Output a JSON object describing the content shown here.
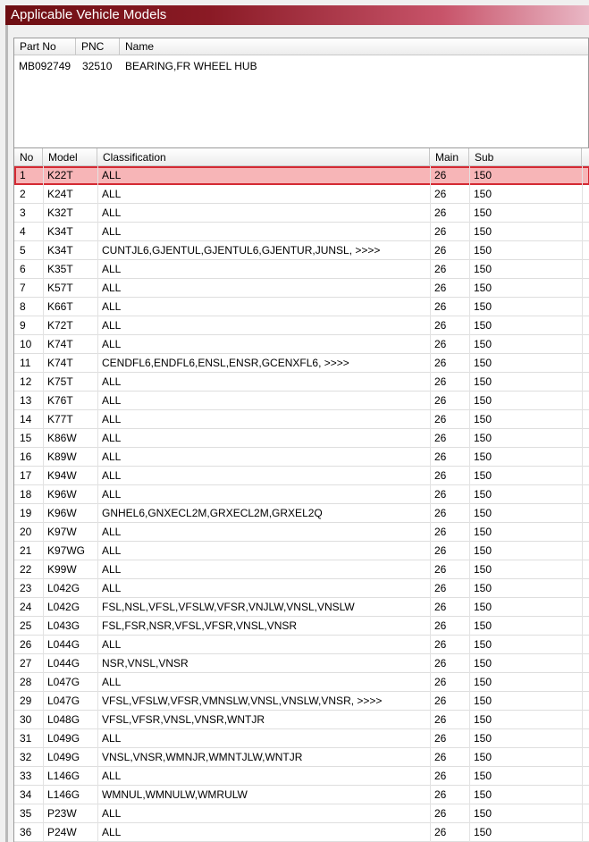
{
  "window": {
    "title": "Applicable Vehicle Models"
  },
  "part": {
    "headers": {
      "part_no": "Part No",
      "pnc": "PNC",
      "name": "Name"
    },
    "part_no": "MB092749",
    "pnc": "32510",
    "name": "BEARING,FR WHEEL HUB"
  },
  "grid": {
    "headers": {
      "no": "No",
      "model": "Model",
      "classification": "Classification",
      "main": "Main",
      "sub": "Sub"
    },
    "selected_row": 1,
    "rows": [
      {
        "no": "1",
        "model": "K22T",
        "classification": "ALL",
        "main": "26",
        "sub": "150"
      },
      {
        "no": "2",
        "model": "K24T",
        "classification": "ALL",
        "main": "26",
        "sub": "150"
      },
      {
        "no": "3",
        "model": "K32T",
        "classification": "ALL",
        "main": "26",
        "sub": "150"
      },
      {
        "no": "4",
        "model": "K34T",
        "classification": "ALL",
        "main": "26",
        "sub": "150"
      },
      {
        "no": "5",
        "model": "K34T",
        "classification": "CUNTJL6,GJENTUL,GJENTUL6,GJENTUR,JUNSL,   >>>>",
        "main": "26",
        "sub": "150"
      },
      {
        "no": "6",
        "model": "K35T",
        "classification": "ALL",
        "main": "26",
        "sub": "150"
      },
      {
        "no": "7",
        "model": "K57T",
        "classification": "ALL",
        "main": "26",
        "sub": "150"
      },
      {
        "no": "8",
        "model": "K66T",
        "classification": "ALL",
        "main": "26",
        "sub": "150"
      },
      {
        "no": "9",
        "model": "K72T",
        "classification": "ALL",
        "main": "26",
        "sub": "150"
      },
      {
        "no": "10",
        "model": "K74T",
        "classification": "ALL",
        "main": "26",
        "sub": "150"
      },
      {
        "no": "11",
        "model": "K74T",
        "classification": "CENDFL6,ENDFL6,ENSL,ENSR,GCENXFL6,   >>>>",
        "main": "26",
        "sub": "150"
      },
      {
        "no": "12",
        "model": "K75T",
        "classification": "ALL",
        "main": "26",
        "sub": "150"
      },
      {
        "no": "13",
        "model": "K76T",
        "classification": "ALL",
        "main": "26",
        "sub": "150"
      },
      {
        "no": "14",
        "model": "K77T",
        "classification": "ALL",
        "main": "26",
        "sub": "150"
      },
      {
        "no": "15",
        "model": "K86W",
        "classification": "ALL",
        "main": "26",
        "sub": "150"
      },
      {
        "no": "16",
        "model": "K89W",
        "classification": "ALL",
        "main": "26",
        "sub": "150"
      },
      {
        "no": "17",
        "model": "K94W",
        "classification": "ALL",
        "main": "26",
        "sub": "150"
      },
      {
        "no": "18",
        "model": "K96W",
        "classification": "ALL",
        "main": "26",
        "sub": "150"
      },
      {
        "no": "19",
        "model": "K96W",
        "classification": "GNHEL6,GNXECL2M,GRXECL2M,GRXEL2Q",
        "main": "26",
        "sub": "150"
      },
      {
        "no": "20",
        "model": "K97W",
        "classification": "ALL",
        "main": "26",
        "sub": "150"
      },
      {
        "no": "21",
        "model": "K97WG",
        "classification": "ALL",
        "main": "26",
        "sub": "150"
      },
      {
        "no": "22",
        "model": "K99W",
        "classification": "ALL",
        "main": "26",
        "sub": "150"
      },
      {
        "no": "23",
        "model": "L042G",
        "classification": "ALL",
        "main": "26",
        "sub": "150"
      },
      {
        "no": "24",
        "model": "L042G",
        "classification": "FSL,NSL,VFSL,VFSLW,VFSR,VNJLW,VNSL,VNSLW",
        "main": "26",
        "sub": "150"
      },
      {
        "no": "25",
        "model": "L043G",
        "classification": "FSL,FSR,NSR,VFSL,VFSR,VNSL,VNSR",
        "main": "26",
        "sub": "150"
      },
      {
        "no": "26",
        "model": "L044G",
        "classification": "ALL",
        "main": "26",
        "sub": "150"
      },
      {
        "no": "27",
        "model": "L044G",
        "classification": "NSR,VNSL,VNSR",
        "main": "26",
        "sub": "150"
      },
      {
        "no": "28",
        "model": "L047G",
        "classification": "ALL",
        "main": "26",
        "sub": "150"
      },
      {
        "no": "29",
        "model": "L047G",
        "classification": "VFSL,VFSLW,VFSR,VMNSLW,VNSL,VNSLW,VNSR,   >>>>",
        "main": "26",
        "sub": "150"
      },
      {
        "no": "30",
        "model": "L048G",
        "classification": "VFSL,VFSR,VNSL,VNSR,WNTJR",
        "main": "26",
        "sub": "150"
      },
      {
        "no": "31",
        "model": "L049G",
        "classification": "ALL",
        "main": "26",
        "sub": "150"
      },
      {
        "no": "32",
        "model": "L049G",
        "classification": "VNSL,VNSR,WMNJR,WMNTJLW,WNTJR",
        "main": "26",
        "sub": "150"
      },
      {
        "no": "33",
        "model": "L146G",
        "classification": "ALL",
        "main": "26",
        "sub": "150"
      },
      {
        "no": "34",
        "model": "L146G",
        "classification": "WMNUL,WMNULW,WMRULW",
        "main": "26",
        "sub": "150"
      },
      {
        "no": "35",
        "model": "P23W",
        "classification": "ALL",
        "main": "26",
        "sub": "150"
      },
      {
        "no": "36",
        "model": "P24W",
        "classification": "ALL",
        "main": "26",
        "sub": "150"
      }
    ]
  }
}
